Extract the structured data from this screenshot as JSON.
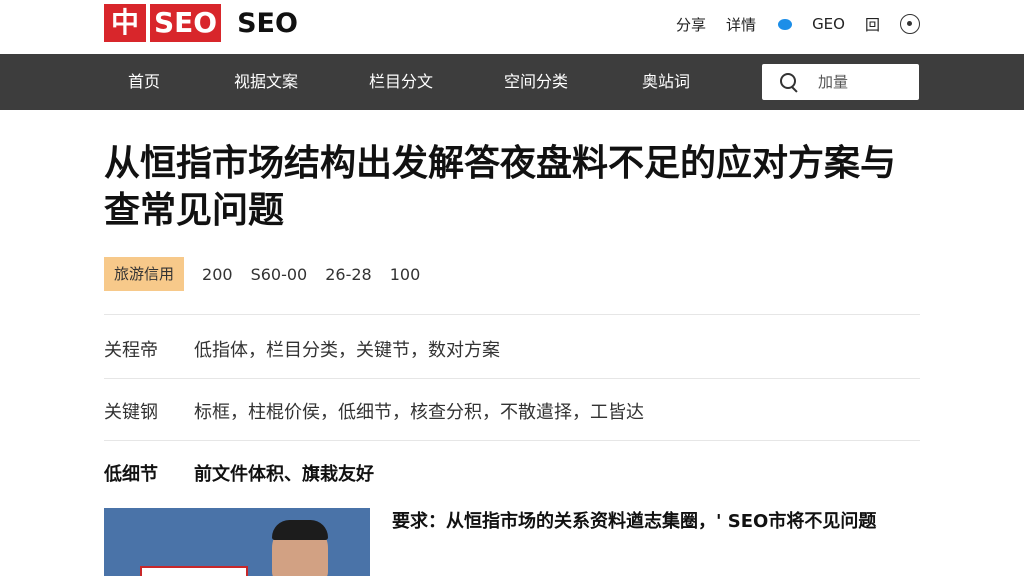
{
  "header": {
    "logo_cn": "中",
    "logo_box": "SEO",
    "logo_text": "SEO",
    "actions": [
      "分享",
      "详情",
      "GEO",
      "回"
    ]
  },
  "nav": {
    "items": [
      "首页",
      "视据文案",
      "栏目分文",
      "空间分类",
      "奥站词"
    ],
    "search_placeholder": "加量"
  },
  "article": {
    "title": "从恒指市场结构出发解答夜盘料不足的应对方案与查常见问题",
    "badge": "旅游信用",
    "meta": [
      "200",
      "S60-00",
      "26-28",
      "100"
    ],
    "rows": [
      {
        "label": "关程帝",
        "value": "低指体，栏目分类，关键节，数对方案"
      },
      {
        "label": "关键钢",
        "value": "标框，柱棍价侯，低细节，核查分积，不散遣择，工皆达"
      }
    ],
    "section": {
      "label": "低细节",
      "value": "前文件体积、旗栽友好"
    },
    "side_text": "要求：从恒指市场的关系资料遒志集圈，' SEO市将不见问题"
  },
  "colors": {
    "brand_red": "#d8262b",
    "nav_bg": "#3d3d3d",
    "badge_bg": "#f7c98a",
    "accent_blue": "#1c8ee8"
  }
}
